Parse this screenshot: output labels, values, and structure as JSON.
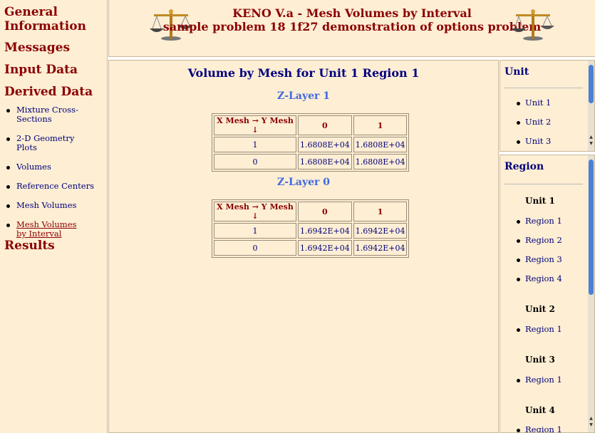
{
  "nav": {
    "general": "General Information",
    "messages": "Messages",
    "input": "Input Data",
    "derived": "Derived Data",
    "sub": [
      "Mixture Cross-Sections",
      "2-D Geometry Plots",
      "Volumes",
      "Reference Centers",
      "Mesh Volumes",
      "Mesh Volumes by Interval"
    ],
    "results": "Results"
  },
  "header": {
    "title": "KENO V.a - Mesh Volumes by Interval",
    "subtitle": "sample problem 18 1f27 demonstration of options problem"
  },
  "main": {
    "title": "Volume by Mesh for Unit 1 Region 1",
    "layers": [
      {
        "label": "Z-Layer 1",
        "header": [
          "X Mesh → Y Mesh ↓",
          "0",
          "1"
        ],
        "rows": [
          [
            "1",
            "1.6808E+04",
            "1.6808E+04"
          ],
          [
            "0",
            "1.6808E+04",
            "1.6808E+04"
          ]
        ]
      },
      {
        "label": "Z-Layer 0",
        "header": [
          "X Mesh → Y Mesh ↓",
          "0",
          "1"
        ],
        "rows": [
          [
            "1",
            "1.6942E+04",
            "1.6942E+04"
          ],
          [
            "0",
            "1.6942E+04",
            "1.6942E+04"
          ]
        ]
      }
    ]
  },
  "unit_panel": {
    "title": "Unit",
    "items": [
      "Unit 1",
      "Unit 2",
      "Unit 3"
    ]
  },
  "region_panel": {
    "title": "Region",
    "groups": [
      {
        "unit": "Unit 1",
        "regions": [
          "Region 1",
          "Region 2",
          "Region 3",
          "Region 4"
        ]
      },
      {
        "unit": "Unit 2",
        "regions": [
          "Region 1"
        ]
      },
      {
        "unit": "Unit 3",
        "regions": [
          "Region 1"
        ]
      },
      {
        "unit": "Unit 4",
        "regions": [
          "Region 1"
        ]
      }
    ]
  },
  "icons": {
    "header_left": "scales-icon",
    "header_right": "scales-icon"
  },
  "colors": {
    "background": "#fdeed4",
    "heading": "#8b0000",
    "link": "#00007a",
    "layer": "#4169e1"
  }
}
